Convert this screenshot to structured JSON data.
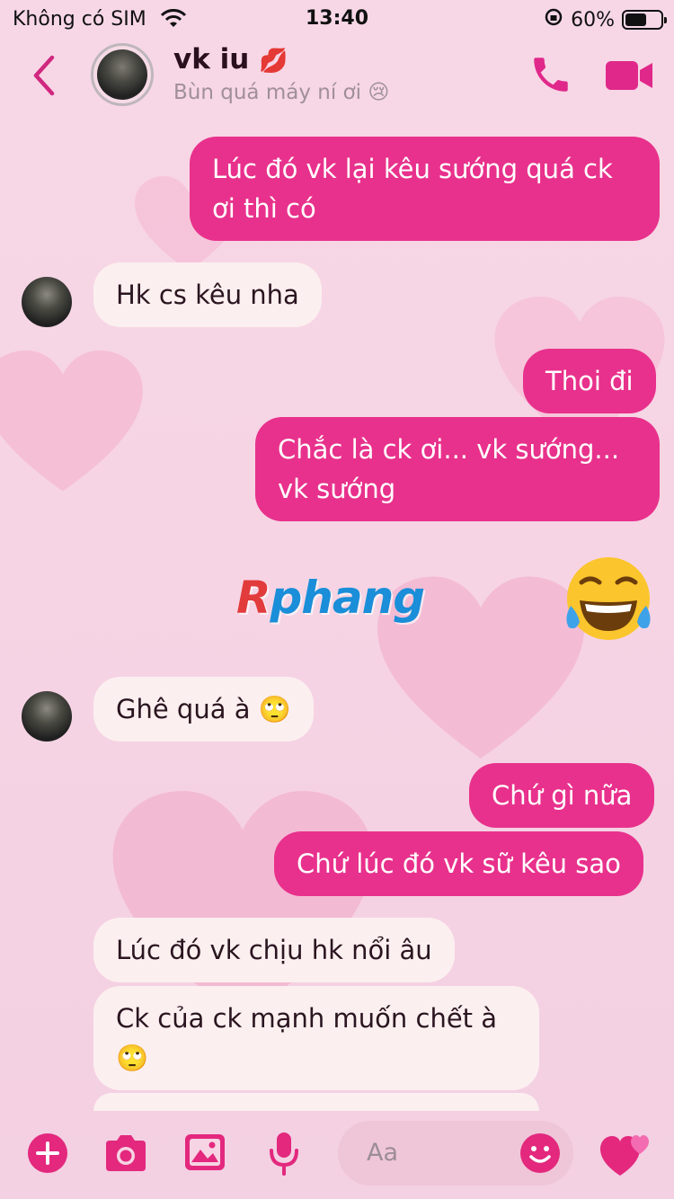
{
  "status_bar": {
    "carrier": "Không có SIM",
    "time": "13:40",
    "battery": "60%",
    "battery_level": 0.6
  },
  "header": {
    "name": "vk iu",
    "name_emoji": "💋",
    "subtitle": "Bùn quá máy ní ơi",
    "subtitle_emoji": "😢"
  },
  "messages": [
    {
      "side": "sent",
      "text": "Lúc đó vk lại kêu sướng quá ck ơi thì có"
    },
    {
      "side": "received",
      "text": "Hk cs kêu nha"
    },
    {
      "side": "sent",
      "text": "Thoi đi"
    },
    {
      "side": "sent",
      "text": "Chắc là ck ơi... vk sướng... vk sướng"
    },
    {
      "side": "sent",
      "text": "😂"
    },
    {
      "side": "received",
      "text": "Ghê quá à 🙄"
    },
    {
      "side": "sent",
      "text": "Chứ gì nữa"
    },
    {
      "side": "sent",
      "text": "Chứ lúc đó vk sữ kêu sao"
    },
    {
      "side": "received",
      "text": "Lúc đó vk chịu hk nổi âu"
    },
    {
      "side": "received",
      "text": "Ck của ck mạnh muốn chết à 🙄"
    }
  ],
  "watermark": {
    "r": "R",
    "rest": "phang"
  },
  "composer": {
    "placeholder": "Aa"
  },
  "icons": [
    "back-chevron-icon",
    "phone-icon",
    "video-icon",
    "plus-icon",
    "camera-icon",
    "image-icon",
    "microphone-icon",
    "smiley-icon",
    "hearts-icon"
  ],
  "colors": {
    "accent": "#e8318c",
    "received_bubble": "#fcefef",
    "background": "#f6d4e4"
  }
}
